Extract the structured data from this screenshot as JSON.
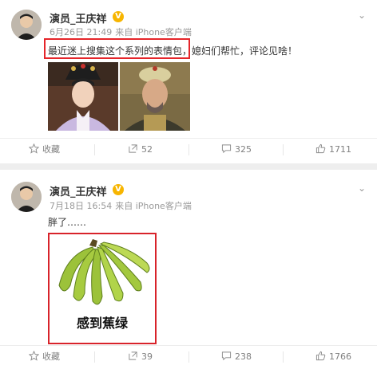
{
  "posts": [
    {
      "username": "演员_王庆祥",
      "verified_badge": "V",
      "date": "6月26日 21:49",
      "source": "来自 iPhone客户端",
      "text_highlighted": "最近迷上搜集这个系列的表情包，",
      "text_rest": "媳妇们帮忙，评论见啥！",
      "actions": {
        "favorite": "收藏",
        "repost": "52",
        "comment": "325",
        "like": "1711"
      }
    },
    {
      "username": "演员_王庆祥",
      "verified_badge": "V",
      "date": "7月18日 16:54",
      "source": "来自 iPhone客户端",
      "text": "胖了……",
      "meme_caption": "感到蕉绿",
      "actions": {
        "favorite": "收藏",
        "repost": "39",
        "comment": "238",
        "like": "1766"
      }
    }
  ],
  "colors": {
    "highlight": "#e5252a",
    "verified": "#f7b500",
    "banana": "#9cc23a"
  },
  "icons": [
    "chevron-down-icon",
    "star-icon",
    "repost-icon",
    "comment-icon",
    "thumbs-up-icon"
  ]
}
